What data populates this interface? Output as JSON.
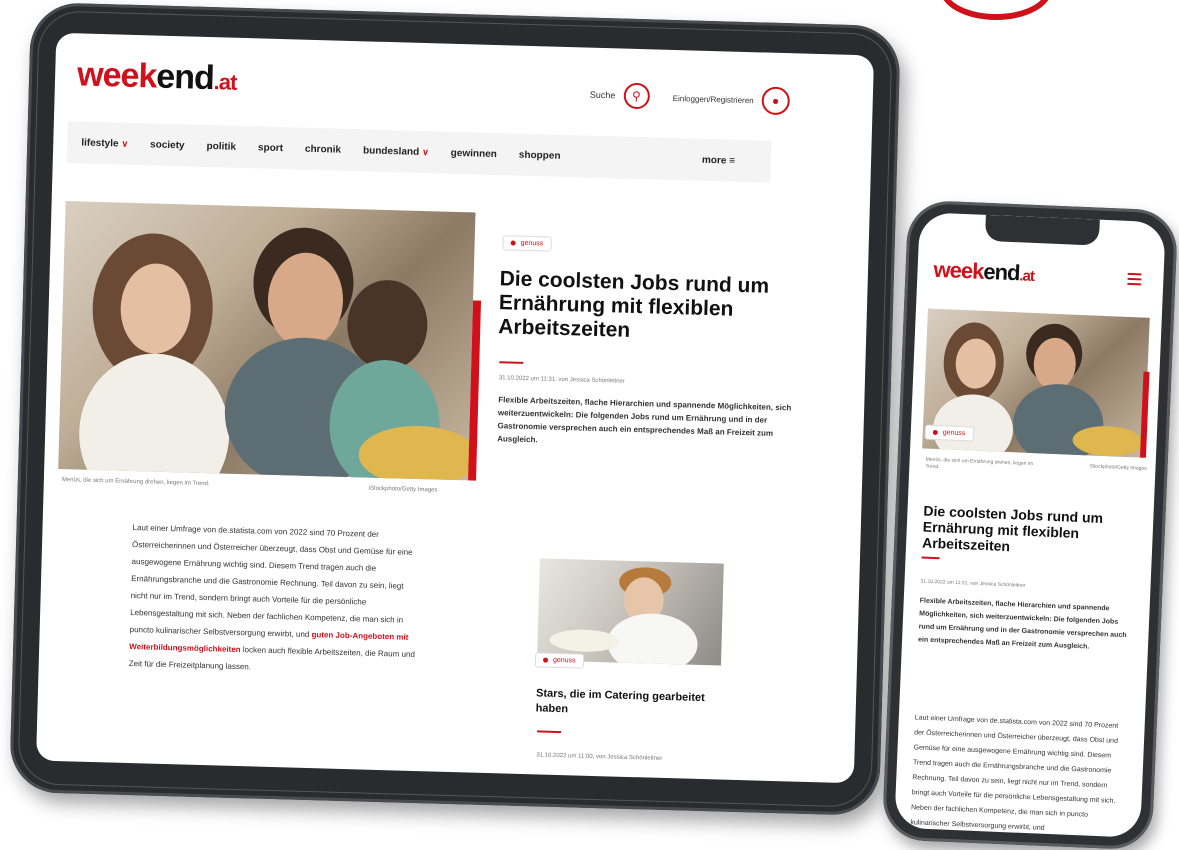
{
  "logo": {
    "part1": "week",
    "part2": "end",
    "part3": ".at"
  },
  "header": {
    "search_label": "Suche",
    "login_label": "Einloggen/Registrieren"
  },
  "nav": {
    "items": [
      {
        "label": "lifestyle",
        "dropdown": true
      },
      {
        "label": "society",
        "dropdown": false
      },
      {
        "label": "politik",
        "dropdown": false
      },
      {
        "label": "sport",
        "dropdown": false
      },
      {
        "label": "chronik",
        "dropdown": false
      },
      {
        "label": "bundesland",
        "dropdown": true
      },
      {
        "label": "gewinnen",
        "dropdown": false
      },
      {
        "label": "shoppen",
        "dropdown": false
      }
    ],
    "more_label": "more"
  },
  "article": {
    "tag": "genuss",
    "title": "Die coolsten Jobs rund um Ernährung mit flexiblen Arbeitszeiten",
    "meta": "31.10.2022 um 11:31, von Jessica Schönleitner",
    "lead": "Flexible Arbeitszeiten, flache Hierarchien und spannende Möglichkeiten, sich weiterzuentwickeln: Die folgenden Jobs rund um Ernährung und in der Gastronomie versprechen auch ein entsprechendes Maß an Freizeit zum Ausgleich.",
    "image_caption": "Menüs, die sich um Ernährung drehen, liegen im Trend.",
    "image_credit": "iStockphoto/Getty Images",
    "body_pre": "Laut einer Umfrage von de.statista.com von 2022 sind 70 Prozent der Österreicherinnen und Österreicher überzeugt, dass Obst und Gemüse für eine ausgewogene Ernährung wichtig sind. Diesem Trend tragen auch die Ernährungsbranche und die Gastronomie Rechnung. Teil davon zu sein, liegt nicht nur im Trend, sondern bringt auch Vorteile für die persönliche Lebensgestaltung mit sich. Neben der fachlichen Kompetenz, die man sich in puncto kulinarischer Selbstversorgung erwirbt, und ",
    "body_link": "guten Job-Angeboten mit Weiterbildungsmöglichkeiten",
    "body_post": " locken auch flexible Arbeitszeiten, die Raum und Zeit für die Freizeitplanung lassen."
  },
  "related": {
    "tag": "genuss",
    "title": "Stars, die im Catering gearbeitet haben",
    "meta": "31.10.2022 um 11:00, von Jessica Schönleitner"
  },
  "colors": {
    "accent": "#d0111b",
    "text": "#1a1a1a",
    "nav_bg": "#f4f4f4"
  }
}
